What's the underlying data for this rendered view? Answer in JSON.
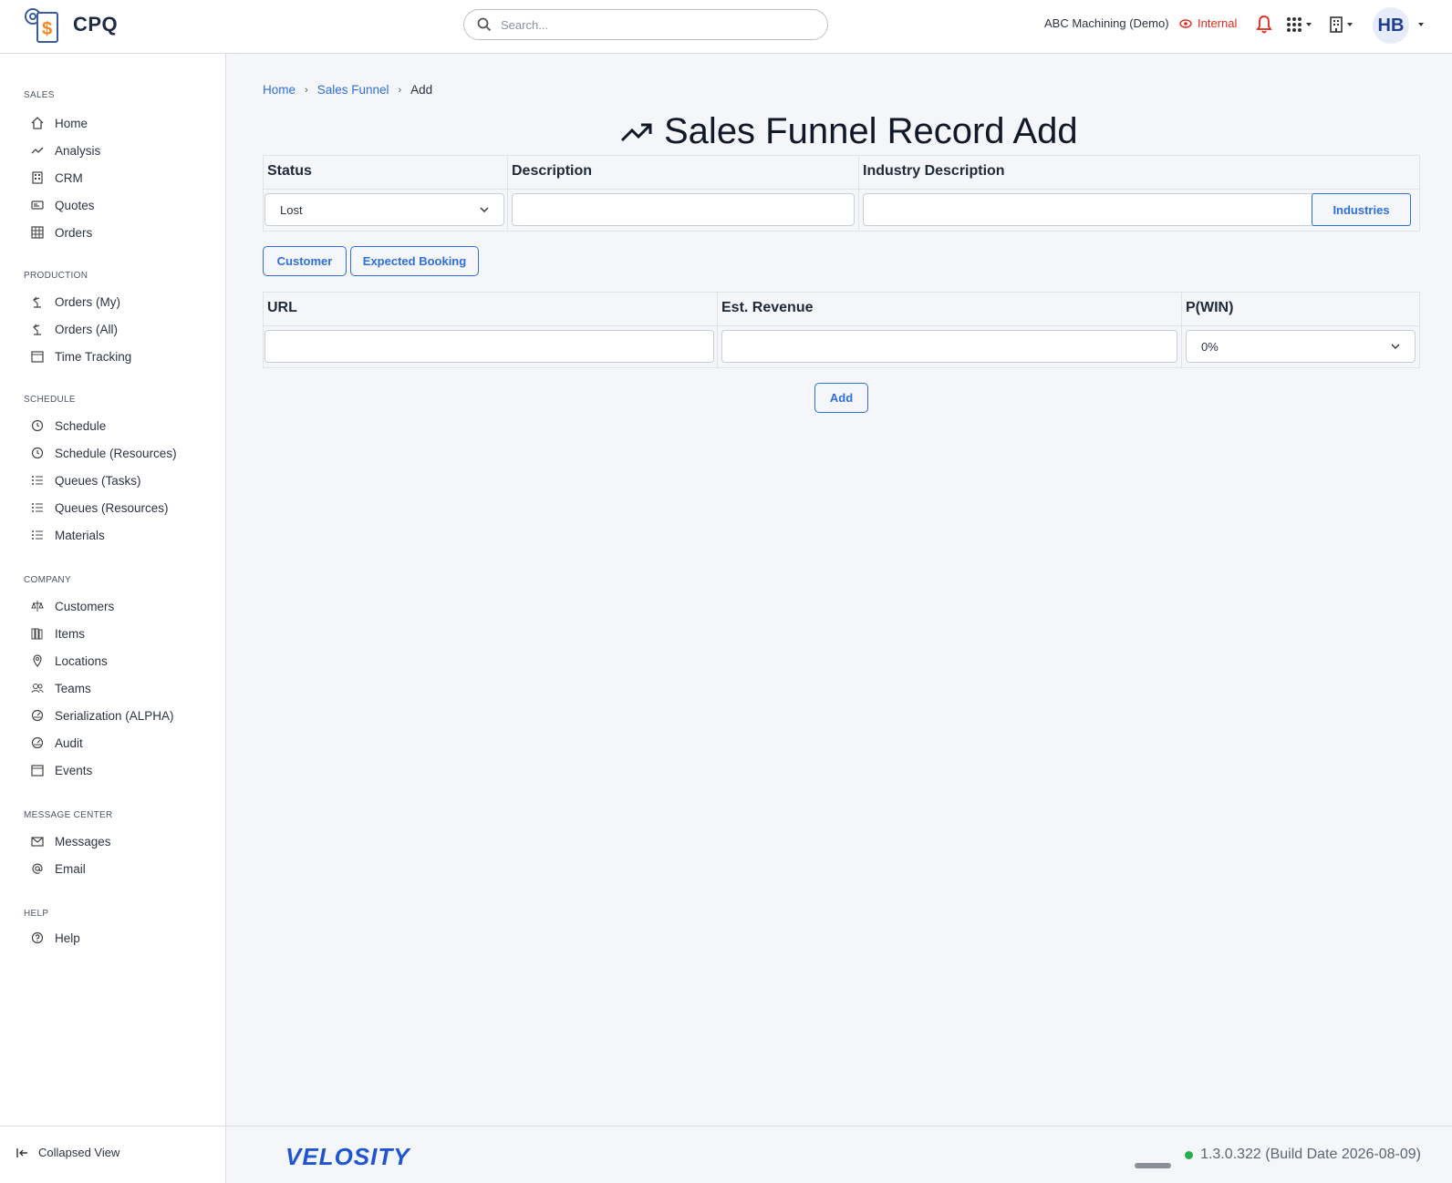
{
  "app": {
    "name": "CPQ",
    "search_placeholder": "Search...",
    "company": "ABC Machining (Demo)",
    "mode": "Internal",
    "avatar_initials": "HB"
  },
  "sidebar": {
    "sections": [
      {
        "title": "SALES",
        "items": [
          {
            "label": "Home",
            "icon": "home-icon"
          },
          {
            "label": "Analysis",
            "icon": "trend-icon"
          },
          {
            "label": "CRM",
            "icon": "building-icon"
          },
          {
            "label": "Quotes",
            "icon": "quote-icon"
          },
          {
            "label": "Orders",
            "icon": "table-icon"
          }
        ]
      },
      {
        "title": "PRODUCTION",
        "items": [
          {
            "label": "Orders (My)",
            "icon": "robot-arm-icon"
          },
          {
            "label": "Orders (All)",
            "icon": "robot-arm-icon"
          },
          {
            "label": "Time Tracking",
            "icon": "calendar-icon"
          }
        ]
      },
      {
        "title": "SCHEDULE",
        "items": [
          {
            "label": "Schedule",
            "icon": "clock-icon"
          },
          {
            "label": "Schedule (Resources)",
            "icon": "clock-icon"
          },
          {
            "label": "Queues (Tasks)",
            "icon": "list-icon"
          },
          {
            "label": "Queues (Resources)",
            "icon": "list-icon"
          },
          {
            "label": "Materials",
            "icon": "list-icon"
          }
        ]
      },
      {
        "title": "COMPANY",
        "items": [
          {
            "label": "Customers",
            "icon": "scale-icon"
          },
          {
            "label": "Items",
            "icon": "books-icon"
          },
          {
            "label": "Locations",
            "icon": "pin-icon"
          },
          {
            "label": "Teams",
            "icon": "users-icon"
          },
          {
            "label": "Serialization (ALPHA)",
            "icon": "gauge-icon"
          },
          {
            "label": "Audit",
            "icon": "gauge-icon"
          },
          {
            "label": "Events",
            "icon": "calendar-icon"
          }
        ]
      },
      {
        "title": "MESSAGE CENTER",
        "items": [
          {
            "label": "Messages",
            "icon": "mail-icon"
          },
          {
            "label": "Email",
            "icon": "at-icon"
          }
        ]
      },
      {
        "title": "HELP",
        "items": [
          {
            "label": "Help",
            "icon": "help-icon"
          }
        ]
      }
    ],
    "collapse_label": "Collapsed View"
  },
  "breadcrumb": {
    "home": "Home",
    "parent": "Sales Funnel",
    "current": "Add"
  },
  "page_title": "Sales Funnel Record Add",
  "form": {
    "status_label": "Status",
    "status_value": "Lost",
    "description_label": "Description",
    "description_value": "",
    "industry_label": "Industry Description",
    "industry_value": "",
    "industries_button": "Industries",
    "customer_button": "Customer",
    "expected_booking_button": "Expected Booking",
    "url_label": "URL",
    "url_value": "",
    "revenue_label": "Est. Revenue",
    "revenue_value": "",
    "pwin_label": "P(WIN)",
    "pwin_value": "0%",
    "add_button": "Add"
  },
  "footer": {
    "brand": "VELOSITY",
    "version": "1.3.0.322 (Build Date 2026-08-09)"
  },
  "colors": {
    "accent": "#2e6fd9",
    "internal": "#e0281b",
    "status_online": "#22b14c"
  }
}
